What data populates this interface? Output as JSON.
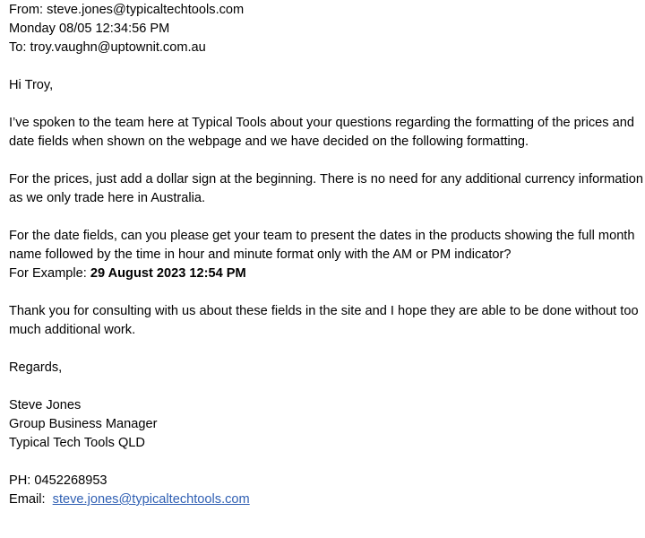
{
  "header": {
    "from": "From: steve.jones@typicaltechtools.com",
    "date": "Monday 08/05 12:34:56 PM",
    "to": "To: troy.vaughn@uptownit.com.au"
  },
  "body": {
    "greeting": "Hi Troy,",
    "para1": "I’ve spoken to the team here at Typical Tools about your questions regarding the formatting of the prices and date fields when shown on the webpage and we have decided on the following formatting.",
    "para2": "For the prices, just add a dollar sign at the beginning. There is no need for any additional currency information as we only trade here in Australia.",
    "para3": "For the date fields, can you please get your team to present the dates in the products showing the full month name followed by the time in hour and minute format only with the AM or PM indicator?",
    "example_label": "For Example: ",
    "example_value": "29 August 2023 12:54 PM",
    "para4": "Thank you for consulting with us about these fields in the site and I hope they are able to be done without too much additional work.",
    "signoff": "Regards,"
  },
  "signature": {
    "name": "Steve Jones",
    "title": "Group Business Manager",
    "company": "Typical Tech Tools QLD",
    "phone": "PH: 0452268953",
    "email_label": "Email:  ",
    "email_link": "steve.jones@typicaltechtools.com"
  }
}
